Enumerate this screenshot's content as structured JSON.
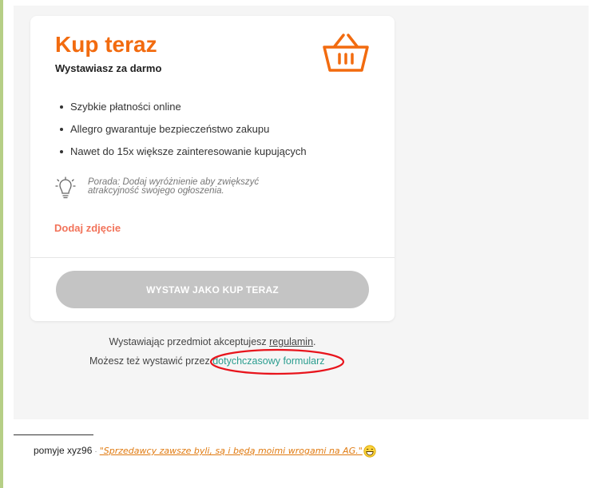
{
  "card": {
    "title": "Kup teraz",
    "subtitle": "Wystawiasz za darmo",
    "features": [
      "Szybkie płatności online",
      "Allegro gwarantuje bezpieczeństwo zakupu",
      "Nawet do 15x większe zainteresowanie kupujących"
    ],
    "tip": "Porada: Dodaj wyróżnienie aby zwiększyć atrakcyjność swojego ogłoszenia.",
    "add_photo": "Dodaj zdjęcie",
    "submit_label": "WYSTAW JAKO KUP TERAZ"
  },
  "terms": {
    "prefix": "Wystawiając przedmiot akceptujesz ",
    "link": "regulamin",
    "suffix": "."
  },
  "alt": {
    "prefix": "Możesz też wystawić przez ",
    "link": "dotychczasowy formularz"
  },
  "signature": {
    "user": "pomyje xyz96",
    "quote": "\"Sprzedawcy zawsze byli, są i będą moimi wrogami na AG.\""
  },
  "colors": {
    "accent": "#f26b0f",
    "link": "#2a9d8f",
    "button_disabled": "#c4c4c4",
    "annotation": "#e8141c"
  }
}
